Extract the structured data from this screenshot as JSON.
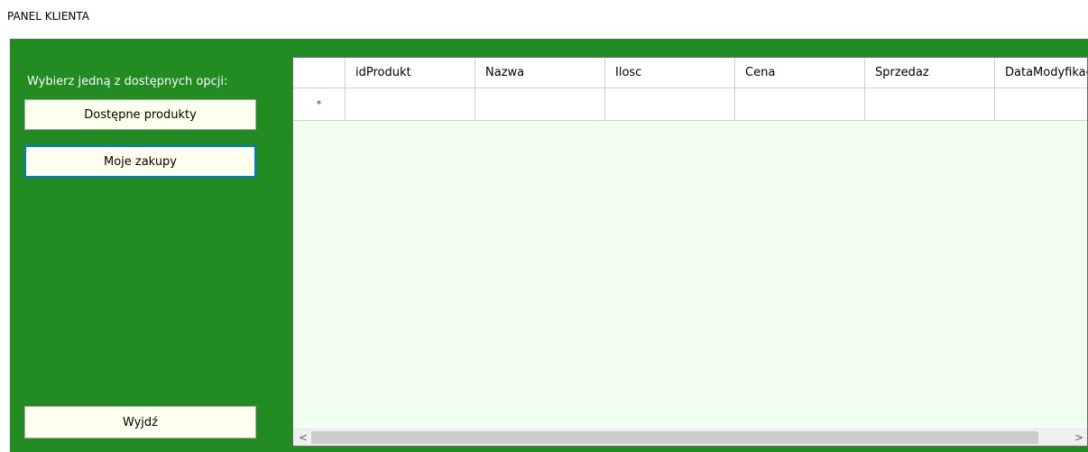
{
  "window": {
    "title": "PANEL KLIENTA"
  },
  "sidebar": {
    "prompt": "Wybierz jedną z dostępnych opcji:",
    "buttons": {
      "products": "Dostępne produkty",
      "purchases": "Moje zakupy",
      "exit": "Wyjdź"
    }
  },
  "grid": {
    "columns": [
      "idProdukt",
      "Nazwa",
      "Ilosc",
      "Cena",
      "Sprzedaz",
      "DataModyfikacji"
    ],
    "new_row_marker": "*",
    "scroll_left": "<",
    "scroll_right": ">"
  },
  "colors": {
    "panel_green": "#228b22",
    "button_bg": "#fffff0",
    "grid_bg": "#f0fff0",
    "focus_border": "#0078d7"
  }
}
